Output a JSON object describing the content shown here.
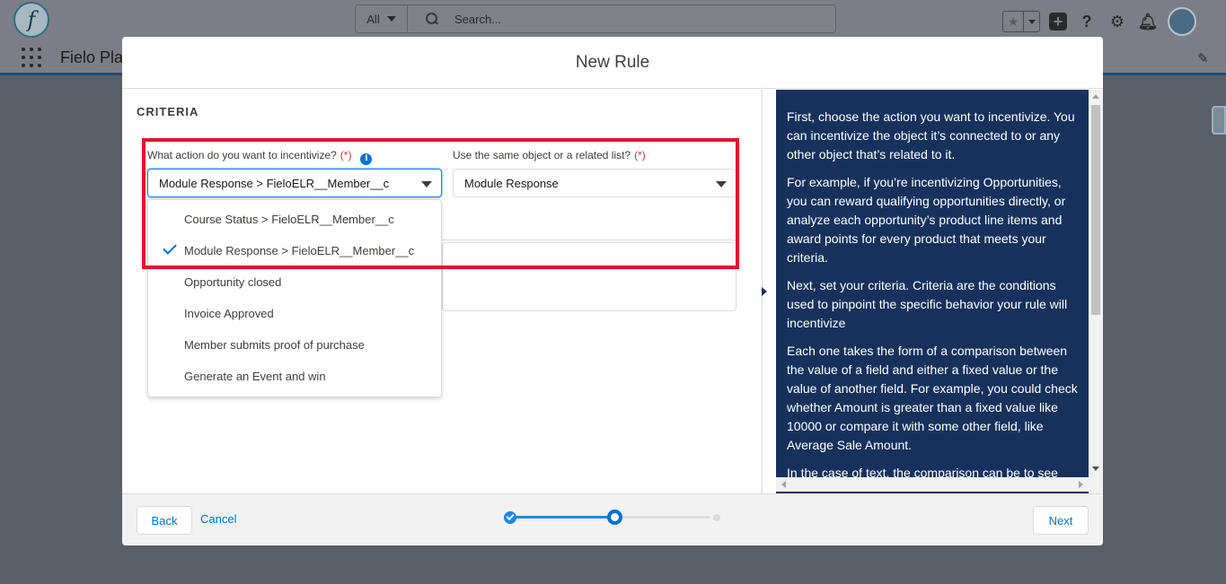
{
  "header": {
    "logo_letter": "f",
    "search_scope": "All",
    "search_placeholder": "Search...",
    "app_name": "Fielo Pla"
  },
  "modal": {
    "title": "New Rule",
    "section_title": "CRITERIA",
    "action_field": {
      "label": "What action do you want to incentivize?",
      "required_marker": "(*)",
      "value": "Module Response > FieloELR__Member__c"
    },
    "object_field": {
      "label": "Use the same object or a related list?",
      "required_marker": "(*)",
      "value": "Module Response"
    },
    "dropdown_options": [
      {
        "label": "Course Status > FieloELR__Member__c",
        "selected": false
      },
      {
        "label": "Module Response > FieloELR__Member__c",
        "selected": true
      },
      {
        "label": "Opportunity closed",
        "selected": false
      },
      {
        "label": "Invoice Approved",
        "selected": false
      },
      {
        "label": "Member submits proof of purchase",
        "selected": false
      },
      {
        "label": "Generate an Event and win",
        "selected": false
      }
    ],
    "help_paragraphs": [
      "First, choose the action you want to incentivize. You can incentivize the object it’s connected to or any other object that’s related to it.",
      "For example, if you’re incentivizing Opportunities, you can reward qualifying opportunities directly, or analyze each opportunity’s product line items and award points for every product that meets your criteria.",
      "Next, set your criteria. Criteria are the conditions used to pinpoint the specific behavior your rule will incentivize",
      "Each one takes the form of a comparison between the value of a field and either a fixed value or the value of another field. For example, you could check whether Amount is greater than a fixed value like 10000 or compare it with some other field, like Average Sale Amount.",
      "In the case of text, the comparison can be to see"
    ],
    "footer": {
      "back_label": "Back",
      "cancel_label": "Cancel",
      "next_label": "Next",
      "progress_steps": 3,
      "progress_current_step": 2
    }
  },
  "colors": {
    "brand_blue": "#0070d2",
    "help_bg": "#16325c",
    "highlight_red": "#e3102e"
  }
}
